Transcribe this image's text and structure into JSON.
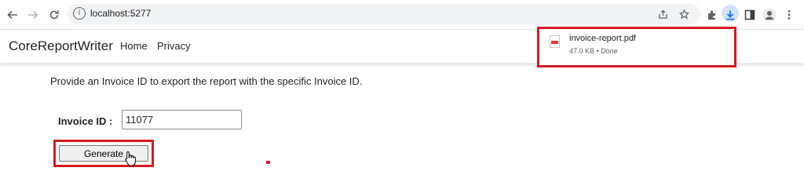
{
  "browser": {
    "url": "localhost:5277",
    "nav_icons": [
      "back-arrow-icon",
      "forward-arrow-icon",
      "reload-icon"
    ],
    "toolbar_icons": [
      "share-icon",
      "bookmark-star-icon",
      "extensions-icon",
      "download-icon",
      "side-panel-icon",
      "profile-avatar-icon",
      "more-menu-icon"
    ],
    "accent_color": "#1a73e8"
  },
  "navbar": {
    "brand": "CoreReportWriter",
    "links": [
      "Home",
      "Privacy"
    ]
  },
  "download": {
    "file_name": "invoice-report.pdf",
    "status": "47.0 KB • Done",
    "icon": "pdf-file-icon"
  },
  "content": {
    "intro": "Provide an Invoice ID to export the report with the specific Invoice ID.",
    "invoice_label": "Invoice ID :",
    "invoice_value": "11077",
    "generate_label": "Generate"
  },
  "highlight_color": "#d71920"
}
